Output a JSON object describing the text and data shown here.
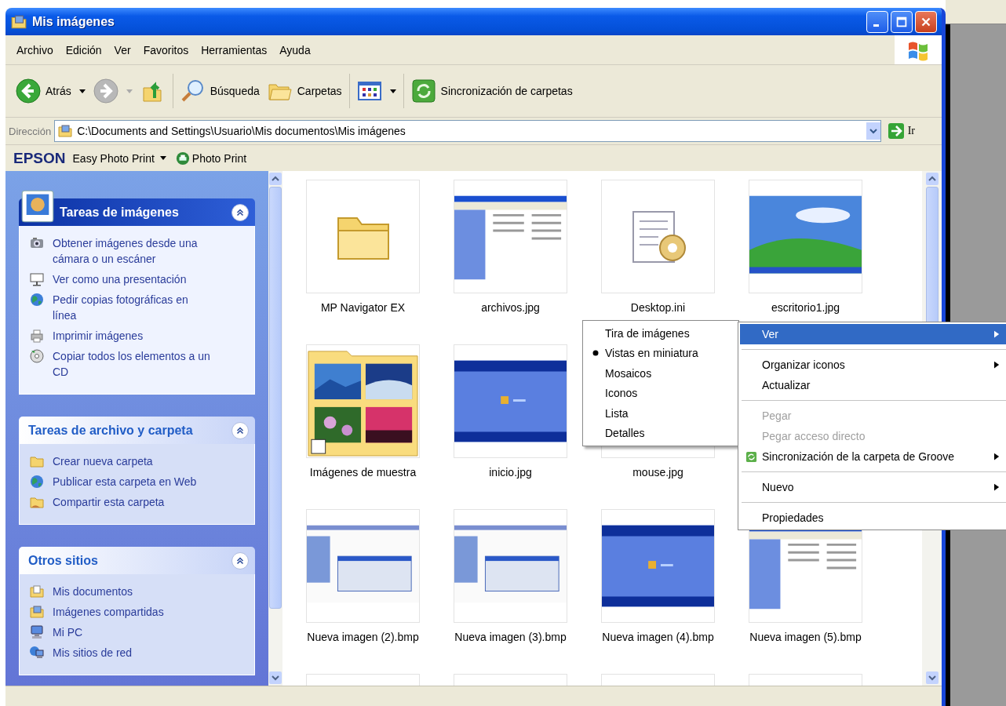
{
  "window": {
    "title": "Mis imágenes"
  },
  "menu_bar": [
    "Archivo",
    "Edición",
    "Ver",
    "Favoritos",
    "Herramientas",
    "Ayuda"
  ],
  "toolbar": {
    "groups": [
      [
        {
          "kind": "back",
          "label": "Atrás",
          "disabled": false
        },
        {
          "kind": "forward",
          "disabled": true
        },
        {
          "kind": "up",
          "disabled": false
        }
      ],
      [
        {
          "kind": "search",
          "label": "Búsqueda"
        },
        {
          "kind": "folders",
          "label": "Carpetas"
        }
      ],
      [
        {
          "kind": "views"
        }
      ],
      [
        {
          "kind": "sync",
          "label": "Sincronización de carpetas"
        }
      ]
    ]
  },
  "address_bar": {
    "label": "Dirección",
    "value": "C:\\Documents and Settings\\Usuario\\Mis documentos\\Mis imágenes",
    "go_label": "Ir"
  },
  "epson_bar": {
    "brand": "EPSON",
    "items": [
      {
        "kind": "menu",
        "label": "Easy Photo Print"
      },
      {
        "kind": "action",
        "label": "Photo Print"
      }
    ]
  },
  "task_panels": [
    {
      "title": "Tareas de imágenes",
      "kind": "primary",
      "expanded": true,
      "items": [
        "Obtener imágenes desde una cámara o un escáner",
        "Ver como una presentación",
        "Pedir copias fotográficas en línea",
        "Imprimir imágenes",
        "Copiar todos los elementos a un CD"
      ]
    },
    {
      "title": "Tareas de archivo y carpeta",
      "kind": "normal",
      "expanded": true,
      "items": [
        "Crear nueva carpeta",
        "Publicar esta carpeta en Web",
        "Compartir esta carpeta"
      ]
    },
    {
      "title": "Otros sitios",
      "kind": "normal",
      "expanded": true,
      "items": [
        "Mis documentos",
        "Imágenes compartidas",
        "Mi PC",
        "Mis sitios de red"
      ]
    }
  ],
  "file_rows": [
    [
      {
        "name": "MP Navigator EX",
        "kind": "folder"
      },
      {
        "name": "archivos.jpg"
      },
      {
        "name": "Desktop.ini",
        "kind": "settings"
      },
      {
        "name": "escritorio1.jpg"
      }
    ],
    [
      {
        "name": "Imágenes de muestra",
        "kind": "photo_folder"
      },
      {
        "name": "inicio.jpg"
      },
      {
        "name": "mouse.jpg",
        "kind": "cut_off"
      }
    ],
    [
      {
        "name": "Nueva imagen (2).bmp"
      },
      {
        "name": "Nueva imagen (3).bmp"
      },
      {
        "name": "Nueva imagen (4).bmp"
      },
      {
        "name": "Nueva imagen (5).bmp"
      }
    ],
    [
      {
        "kind": "cut_off"
      },
      {
        "kind": "cut_off"
      },
      {
        "kind": "cut_off"
      },
      {
        "kind": "cut_off"
      }
    ]
  ],
  "context_menu": {
    "groups": [
      [
        {
          "label": "Ver",
          "kind": "plain",
          "highlighted": true,
          "disabled": false,
          "submenu": true
        }
      ],
      [
        {
          "label": "Organizar iconos",
          "kind": "plain",
          "highlighted": false,
          "disabled": false,
          "submenu": true
        },
        {
          "label": "Actualizar",
          "kind": "plain",
          "highlighted": false,
          "disabled": false,
          "submenu": false
        }
      ],
      [
        {
          "label": "Pegar",
          "kind": "plain",
          "highlighted": false,
          "disabled": true,
          "submenu": false
        },
        {
          "label": "Pegar acceso directo",
          "kind": "plain",
          "highlighted": false,
          "disabled": true,
          "submenu": false
        },
        {
          "label": "Sincronización de la carpeta de Groove",
          "kind": "sync",
          "highlighted": false,
          "disabled": false,
          "submenu": true
        }
      ],
      [
        {
          "label": "Nuevo",
          "kind": "plain",
          "highlighted": false,
          "disabled": false,
          "submenu": true
        }
      ],
      [
        {
          "label": "Propiedades",
          "kind": "plain",
          "highlighted": false,
          "disabled": false,
          "submenu": false
        }
      ]
    ]
  },
  "view_submenu": {
    "items": [
      {
        "label": "Tira de imágenes",
        "selected": false
      },
      {
        "label": "Vistas en miniatura",
        "selected": true
      },
      {
        "label": "Mosaicos",
        "selected": false
      },
      {
        "label": "Iconos",
        "selected": false
      },
      {
        "label": "Lista",
        "selected": false
      },
      {
        "label": "Detalles",
        "selected": false
      }
    ]
  }
}
